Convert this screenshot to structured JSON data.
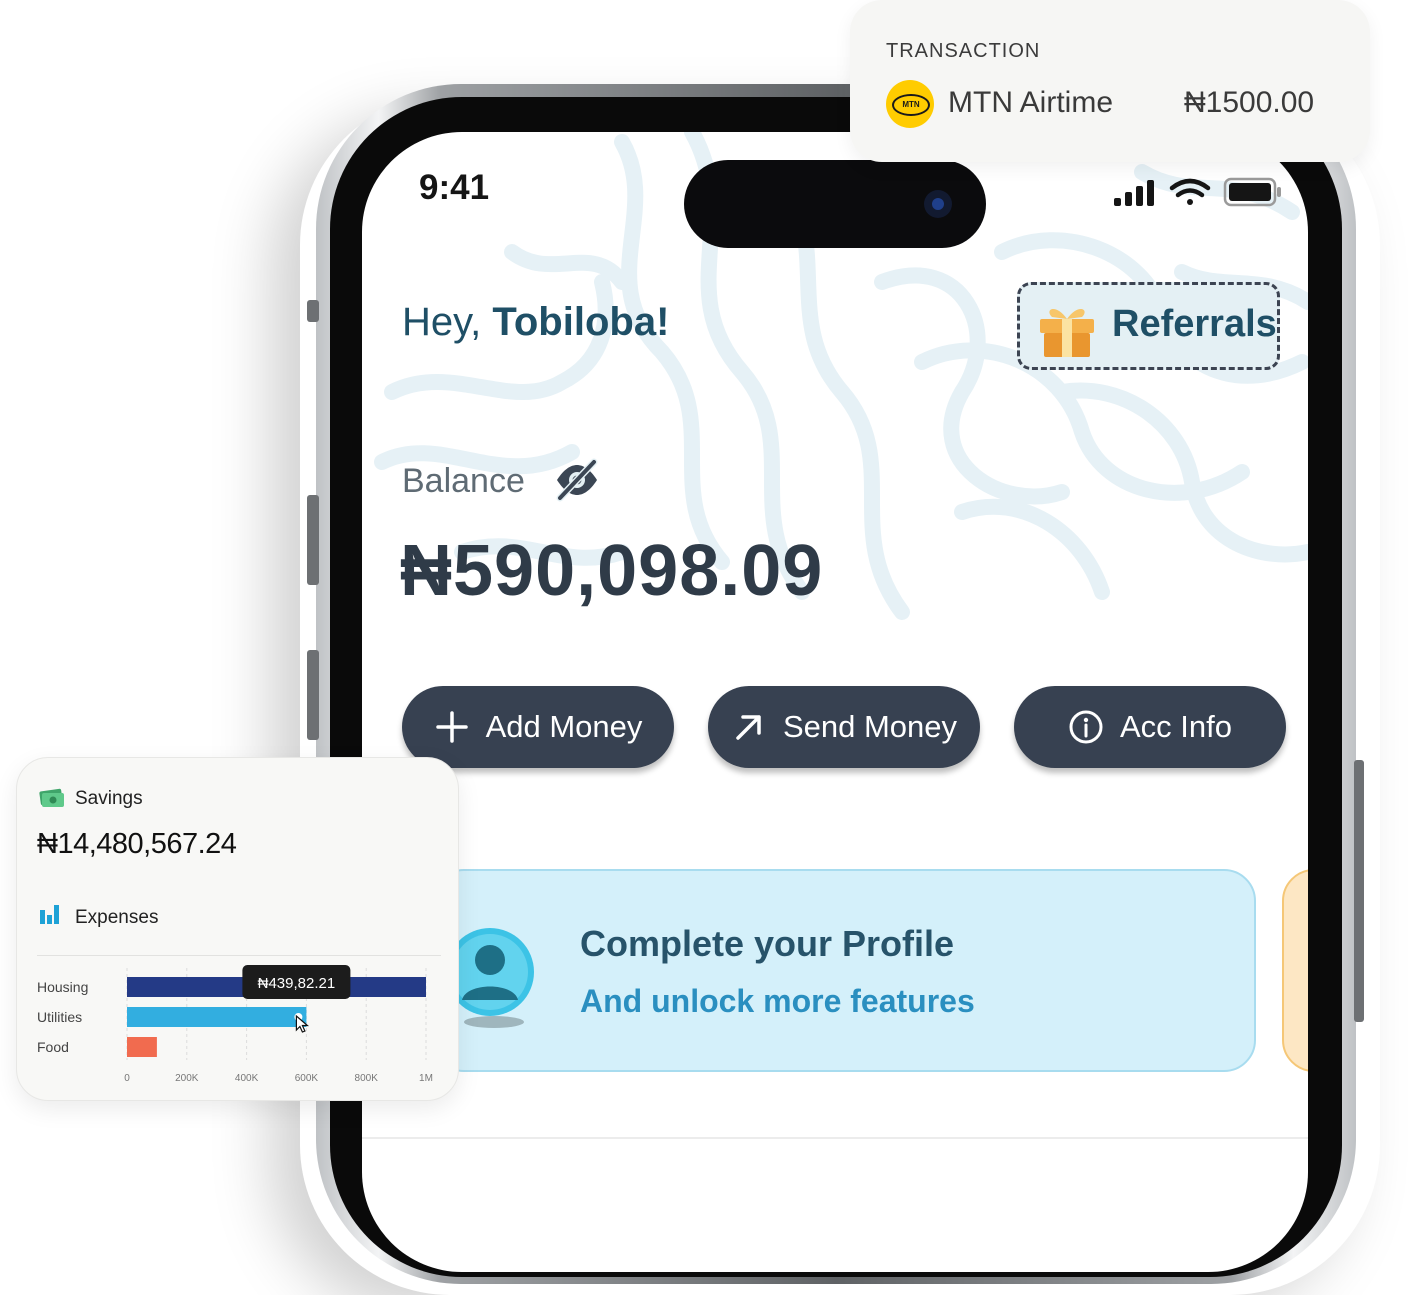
{
  "phone": {
    "status_time": "9:41",
    "greeting_prefix": "Hey, ",
    "greeting_name": "Tobiloba!",
    "referrals_label": "Referrals",
    "balance_label": "Balance",
    "balance_value": "₦590,098.09",
    "actions": [
      {
        "label": "Add Money",
        "icon": "plus-icon"
      },
      {
        "label": "Send Money",
        "icon": "arrow-up-right-icon"
      },
      {
        "label": "Acc Info",
        "icon": "info-icon"
      }
    ],
    "profile_card": {
      "title": "Complete your Profile",
      "subtitle": "And unlock more features"
    }
  },
  "transaction": {
    "heading": "TRANSACTION",
    "logo_text": "MTN",
    "name": "MTN Airtime",
    "amount": "₦1500.00"
  },
  "finance": {
    "savings_label": "Savings",
    "savings_value": "₦14,480,567.24",
    "expenses_label": "Expenses"
  },
  "chart_data": {
    "type": "bar",
    "orientation": "horizontal",
    "categories": [
      "Housing",
      "Utilities",
      "Food"
    ],
    "values": [
      1000000,
      600000,
      100000
    ],
    "colors": [
      "#243a86",
      "#32aee0",
      "#f16b4f"
    ],
    "xlim": [
      0,
      1000000
    ],
    "x_ticks": [
      0,
      200000,
      400000,
      600000,
      800000,
      1000000
    ],
    "x_tick_labels": [
      "0",
      "200K",
      "400K",
      "600K",
      "800K",
      "1M"
    ],
    "tooltip": {
      "category": "Utilities",
      "text": "₦439,82.21"
    }
  },
  "colors": {
    "button_bg": "#374151",
    "greeting": "#1f4f66",
    "profile_card_bg": "#d4f0fa"
  }
}
